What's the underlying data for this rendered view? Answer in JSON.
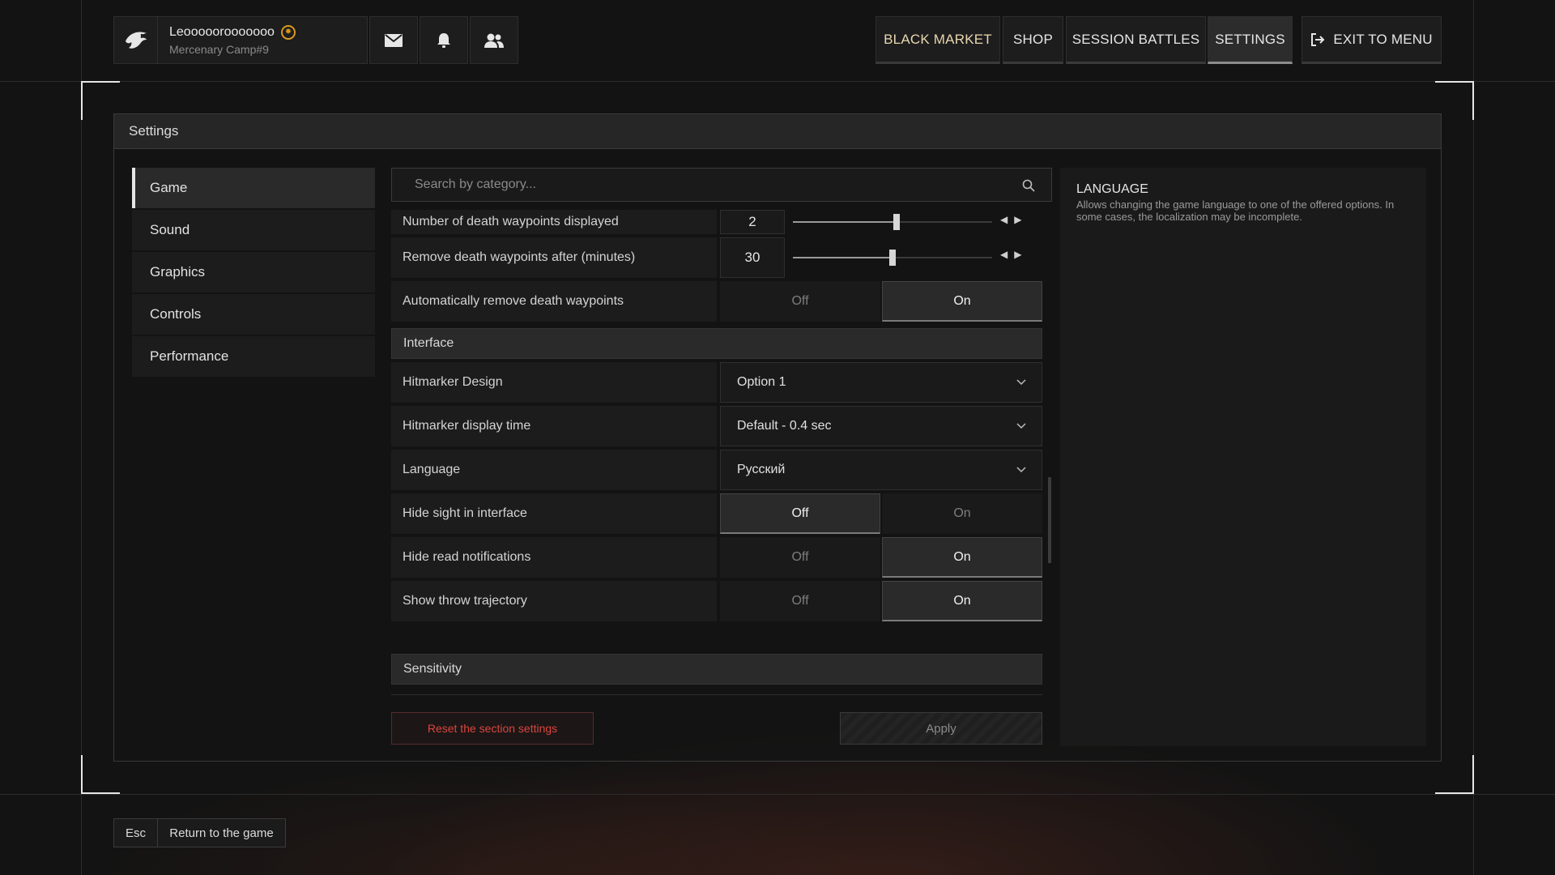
{
  "profile": {
    "name": "Leooooorooooooo",
    "subtitle": "Mercenary Camp#9",
    "logo_icon": "eagle-icon",
    "badge_icon": "rank-badge-icon"
  },
  "top_icons": [
    "mail-icon",
    "bell-icon",
    "friends-icon"
  ],
  "nav": {
    "black_market": "BLACK MARKET",
    "shop": "SHOP",
    "session_battles": "SESSION BATTLES",
    "settings": "SETTINGS",
    "exit": "EXIT TO MENU"
  },
  "panel": {
    "title": "Settings"
  },
  "sidebar": {
    "items": [
      {
        "label": "Game",
        "active": true
      },
      {
        "label": "Sound"
      },
      {
        "label": "Graphics"
      },
      {
        "label": "Controls"
      },
      {
        "label": "Performance"
      }
    ]
  },
  "search": {
    "placeholder": "Search by category..."
  },
  "settings": {
    "death_waypoints": {
      "label": "Number of death waypoints displayed",
      "value": "2",
      "fraction": 0.52
    },
    "remove_after": {
      "label": "Remove death waypoints after (minutes)",
      "value": "30",
      "fraction": 0.5
    },
    "auto_remove": {
      "label": "Automatically remove death waypoints",
      "off": "Off",
      "on": "On",
      "selected": "on"
    },
    "interface_section": "Interface",
    "hitmarker_design": {
      "label": "Hitmarker Design",
      "value": "Option 1"
    },
    "hitmarker_time": {
      "label": "Hitmarker display time",
      "value": "Default - 0.4 sec"
    },
    "language": {
      "label": "Language",
      "value": "Русский"
    },
    "hide_sight": {
      "label": "Hide sight in interface",
      "off": "Off",
      "on": "On",
      "selected": "off"
    },
    "hide_read": {
      "label": "Hide read notifications",
      "off": "Off",
      "on": "On",
      "selected": "on"
    },
    "throw_traj": {
      "label": "Show throw trajectory",
      "off": "Off",
      "on": "On",
      "selected": "on"
    },
    "sensitivity_section": "Sensitivity"
  },
  "actions": {
    "reset": "Reset the section settings",
    "apply": "Apply"
  },
  "info": {
    "title": "LANGUAGE",
    "text": "Allows changing the game language to one of the offered options. In some cases, the localization may be incomplete."
  },
  "footer": {
    "key": "Esc",
    "action": "Return to the game"
  },
  "colors": {
    "accent_warning": "#d8463f",
    "badge": "#d99a1e"
  }
}
